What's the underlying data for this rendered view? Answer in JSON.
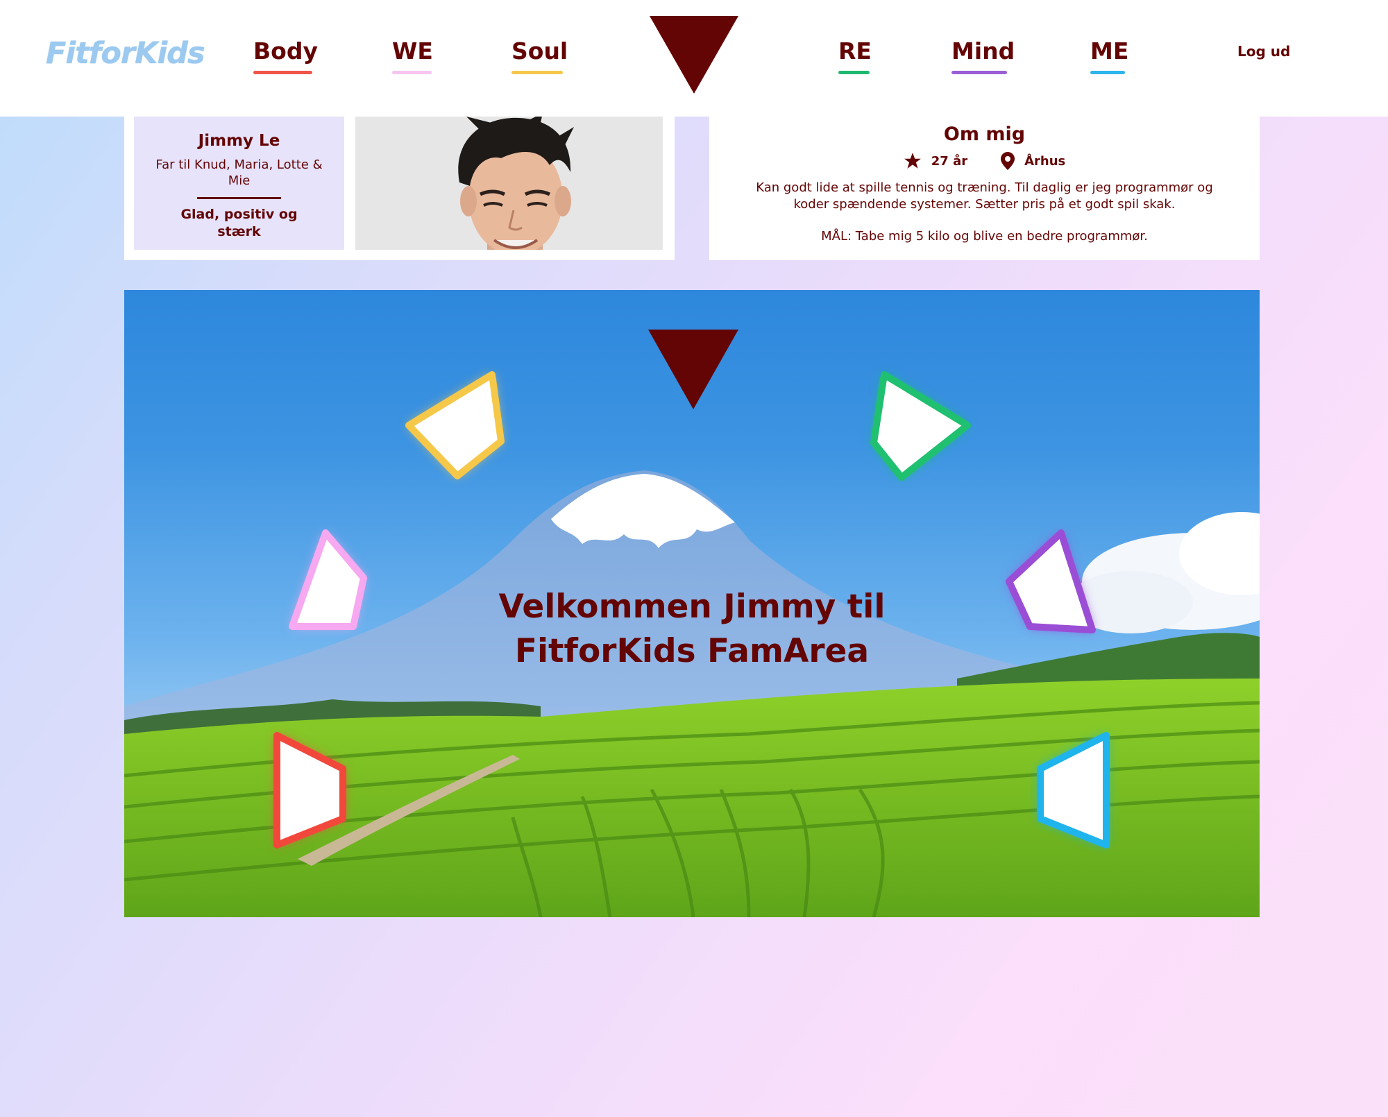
{
  "logo": {
    "text": "FitforKids"
  },
  "nav": {
    "items": [
      {
        "label": "Body",
        "color": "#f0554a"
      },
      {
        "label": "WE",
        "color": "#f6c6f1"
      },
      {
        "label": "Soul",
        "color": "#f5c84a"
      },
      {
        "label": "RE",
        "color": "#1fb870"
      },
      {
        "label": "Mind",
        "color": "#9a5ed6"
      },
      {
        "label": "ME",
        "color": "#2fb4ec"
      }
    ],
    "logout": "Log ud",
    "center_icon": "triangle-down-icon"
  },
  "profile": {
    "name": "Jimmy Le",
    "relation": "Far til Knud, Maria, Lotte & Mie",
    "mood": "Glad, positiv og stærk"
  },
  "about": {
    "title": "Om mig",
    "age": "27 år",
    "age_icon": "star-icon",
    "city": "Århus",
    "city_icon": "location-pin-icon",
    "text": "Kan godt lide at spille tennis og træning. Til daglig er jeg programmør og koder spændende systemer. Sætter pris på et godt spil skak.",
    "goal": "MÅL: Tabe mig 5 kilo og blive en bedre programmør."
  },
  "hero": {
    "title_line1": "Velkommen Jimmy til",
    "title_line2": "FitforKids FamArea",
    "center_icon": "triangle-down-icon",
    "triangles": [
      {
        "name": "soul-triangle",
        "color": "#f5c84a"
      },
      {
        "name": "re-triangle",
        "color": "#1fc070"
      },
      {
        "name": "we-triangle",
        "color": "#f6a8f0"
      },
      {
        "name": "mind-triangle",
        "color": "#9a4ed6"
      },
      {
        "name": "body-triangle",
        "color": "#f2483c"
      },
      {
        "name": "me-triangle",
        "color": "#1fb4ec"
      }
    ]
  },
  "colors": {
    "brand": "#640505",
    "logo": "#9cc9ef"
  }
}
